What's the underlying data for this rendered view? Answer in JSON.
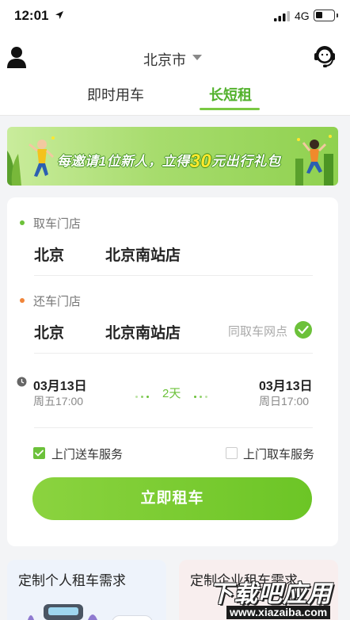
{
  "status_bar": {
    "time": "12:01",
    "network": "4G",
    "icons": [
      "location-arrow-icon",
      "signal-icon",
      "battery-icon"
    ]
  },
  "header": {
    "city": "北京市",
    "tabs": [
      {
        "label": "即时用车",
        "active": false
      },
      {
        "label": "长短租",
        "active": true
      }
    ],
    "icons": [
      "user-icon",
      "customer-service-icon",
      "chevron-down-icon"
    ]
  },
  "banner": {
    "text_before": "每邀请1位新人，立得",
    "amount": "30",
    "text_after": "元",
    "text_tail": "出行礼包"
  },
  "rental_form": {
    "pickup": {
      "label": "取车门店",
      "city": "北京",
      "store": "北京南站店"
    },
    "return": {
      "label": "还车门店",
      "city": "北京",
      "store": "北京南站店",
      "same_as_pickup_label": "同取车网点",
      "same_as_pickup_checked": true
    },
    "schedule": {
      "start_date": "03月13日",
      "start_time": "周五17:00",
      "duration": "2天",
      "end_date": "03月13日",
      "end_time": "周日17:00"
    },
    "options": [
      {
        "label": "上门送车服务",
        "checked": true
      },
      {
        "label": "上门取车服务",
        "checked": false
      }
    ],
    "submit_label": "立即租车"
  },
  "promos": [
    {
      "title": "定制个人租车需求"
    },
    {
      "title": "定制企业租车需求"
    }
  ],
  "watermark": {
    "title": "下载吧应用",
    "url": "www.xiazaiba.com"
  },
  "colors": {
    "brand_green": "#6cc13a",
    "accent_orange": "#f0853a",
    "banner_yellow": "#ffe82d"
  }
}
